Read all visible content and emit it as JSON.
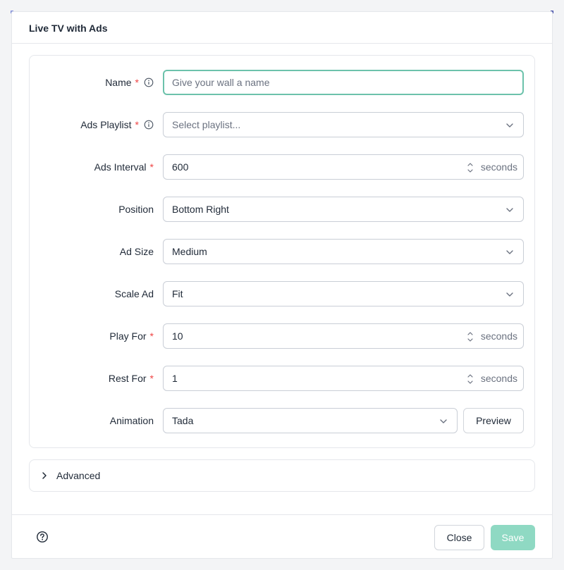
{
  "modal": {
    "title": "Live TV with Ads"
  },
  "form": {
    "name": {
      "label": "Name",
      "placeholder": "Give your wall a name",
      "required": "*"
    },
    "ads_playlist": {
      "label": "Ads Playlist",
      "placeholder": "Select playlist...",
      "required": "*"
    },
    "ads_interval": {
      "label": "Ads Interval",
      "value": "600",
      "unit": "seconds",
      "required": "*"
    },
    "position": {
      "label": "Position",
      "value": "Bottom Right"
    },
    "ad_size": {
      "label": "Ad Size",
      "value": "Medium"
    },
    "scale_ad": {
      "label": "Scale Ad",
      "value": "Fit"
    },
    "play_for": {
      "label": "Play For",
      "value": "10",
      "unit": "seconds",
      "required": "*"
    },
    "rest_for": {
      "label": "Rest For",
      "value": "1",
      "unit": "seconds",
      "required": "*"
    },
    "animation": {
      "label": "Animation",
      "value": "Tada",
      "preview_label": "Preview"
    }
  },
  "advanced": {
    "label": "Advanced"
  },
  "footer": {
    "close_label": "Close",
    "save_label": "Save"
  },
  "colors": {
    "accent": "#6cc2ab",
    "save_disabled": "#8fd9c3",
    "required": "#ef4444"
  },
  "icons": {
    "info": "info-circle-icon",
    "chevron": "chevron-down-icon",
    "stepper": "stepper-arrows-icon",
    "advanced": "chevron-right-icon",
    "help": "question-circle-icon"
  }
}
